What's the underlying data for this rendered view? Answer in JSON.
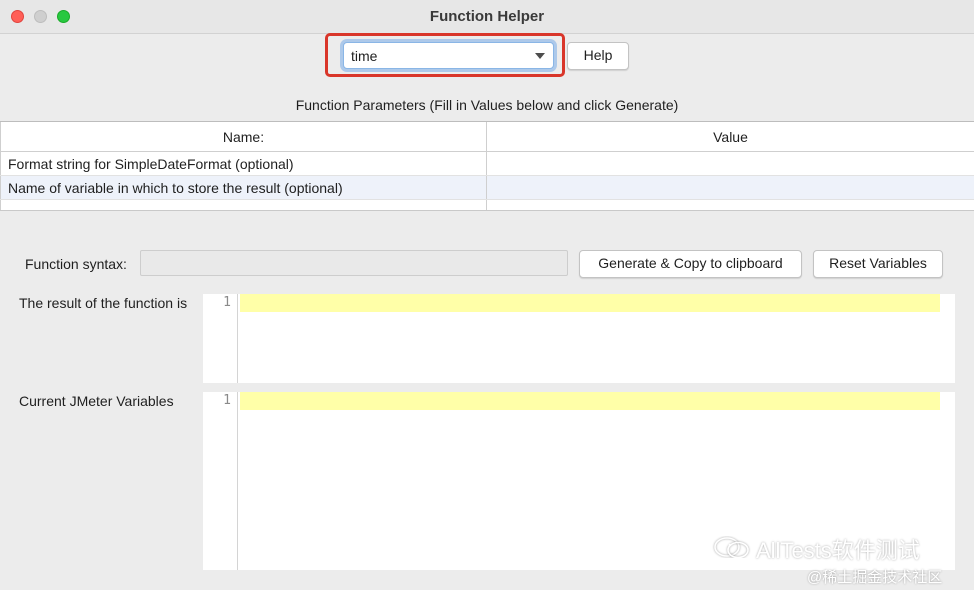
{
  "window": {
    "title": "Function Helper",
    "controls": [
      "close",
      "minimize",
      "zoom"
    ]
  },
  "function_selector": {
    "selected": "time"
  },
  "help_button": {
    "label": "Help"
  },
  "parameters": {
    "caption": "Function Parameters (Fill in Values below and click Generate)",
    "columns": [
      "Name:",
      "Value"
    ],
    "rows": [
      {
        "name": "Format string for SimpleDateFormat (optional)",
        "value": ""
      },
      {
        "name": "Name of variable in which to store the result (optional)",
        "value": ""
      }
    ]
  },
  "syntax": {
    "label": "Function syntax:",
    "value": "",
    "generate_button": "Generate & Copy to clipboard",
    "reset_button": "Reset Variables"
  },
  "result": {
    "label": "The result of the function is",
    "line_number": "1"
  },
  "variables": {
    "label": "Current JMeter Variables",
    "line_number": "1"
  },
  "watermark": {
    "main": "AllTests软件测试",
    "sub": "@稀土掘金技术社区",
    "icon": "wechat-icon"
  },
  "colors": {
    "highlight_border": "#d9362a",
    "focus_ring": "#62a0e8",
    "line_highlight": "#ffffa8",
    "selected_row": "#eef2fa"
  }
}
